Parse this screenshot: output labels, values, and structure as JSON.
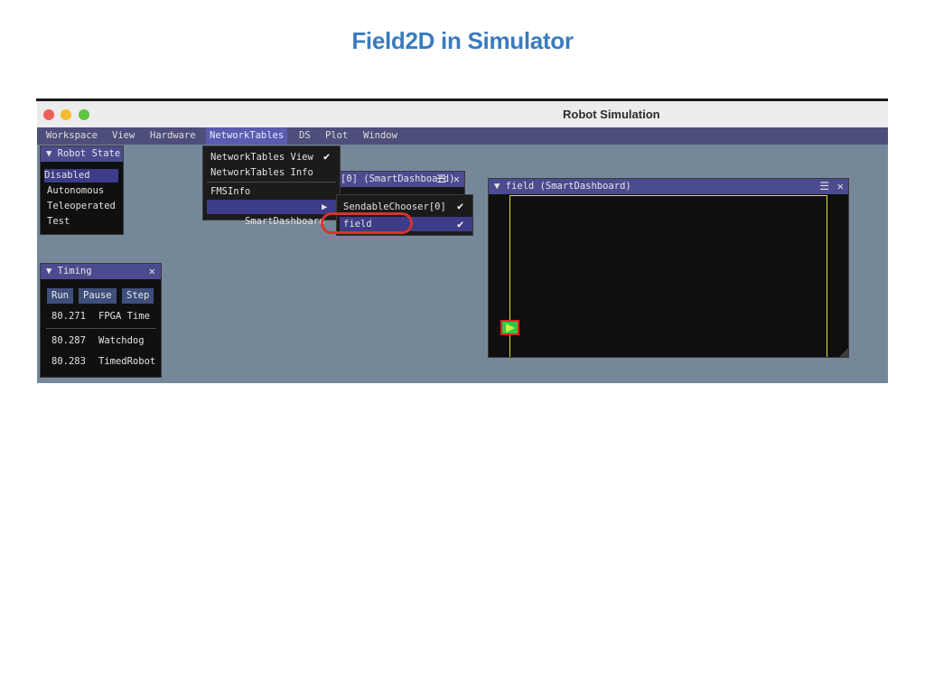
{
  "slide": {
    "title": "Field2D in Simulator"
  },
  "window": {
    "title": "Robot Simulation",
    "traffic_lights": {
      "close_color": "#ee5f57",
      "minimize_color": "#f5bd2e",
      "zoom_color": "#5fc43f"
    }
  },
  "menubar": {
    "items": [
      "Workspace",
      "View",
      "Hardware",
      "NetworkTables",
      "DS",
      "Plot",
      "Window"
    ],
    "active": "NetworkTables"
  },
  "robot_state": {
    "header": "▼ Robot State",
    "options": [
      "Disabled",
      "Autonomous",
      "Teleoperated",
      "Test"
    ],
    "selected": "Disabled"
  },
  "timing": {
    "header": "▼ Timing",
    "close_glyph": "✕",
    "buttons": [
      "Run",
      "Pause",
      "Step"
    ],
    "rows": [
      {
        "value": "80.271",
        "label": "FPGA Time"
      },
      {
        "value": "80.287",
        "label": "Watchdog"
      },
      {
        "value": "80.283",
        "label": "TimedRobot"
      }
    ]
  },
  "networktables_menu": {
    "items": [
      {
        "label": "NetworkTables View",
        "checked": true
      },
      {
        "label": "NetworkTables Info",
        "checked": false
      },
      {
        "label": "FMSInfo",
        "checked": false
      },
      {
        "label": "SmartDashboard",
        "checked": false,
        "submenu_arrow": "▶"
      }
    ],
    "check_glyph": "✔"
  },
  "smartdashboard_submenu": {
    "items": [
      {
        "label": "SendableChooser[0]",
        "checked": true
      },
      {
        "label": "field",
        "checked": true
      }
    ],
    "highlight_color": "#d9322b"
  },
  "hidden_window": {
    "title": "[0] (SmartDashboard)",
    "hamb_glyph": "☰",
    "close_glyph": "✕"
  },
  "field_window": {
    "header": "▼ field (SmartDashboard)",
    "hamb_glyph": "☰",
    "close_glyph": "✕",
    "border_color": "#e6e23a",
    "robot_color": "#39c24a",
    "robot_outline_color": "#e0241b"
  }
}
